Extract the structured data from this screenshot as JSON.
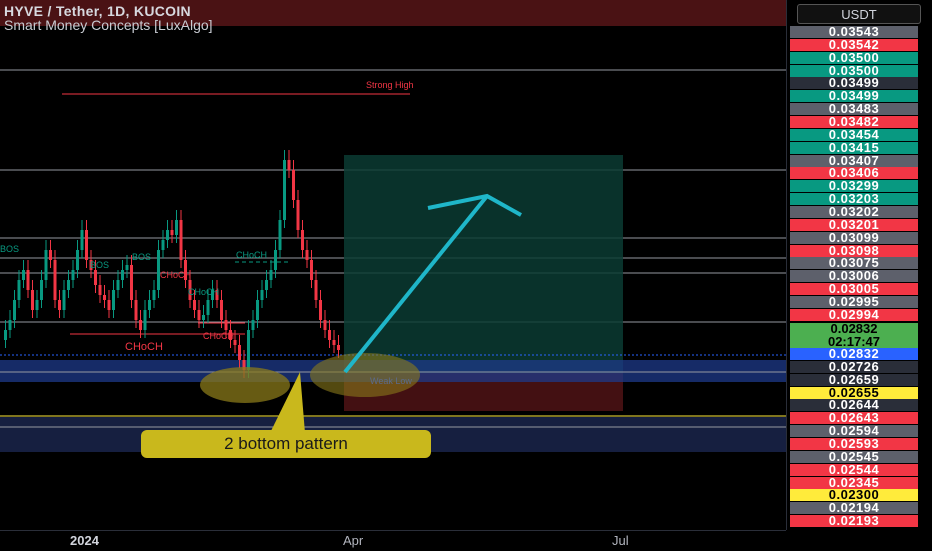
{
  "header": {
    "title": "HYVE / Tether, 1D, KUCOIN",
    "indicator": "Smart Money Concepts [LuxAlgo]"
  },
  "currency": "USDT",
  "price_labels": [
    {
      "v": "0.03543",
      "c": "gray"
    },
    {
      "v": "0.03542",
      "c": "red"
    },
    {
      "v": "0.03500",
      "c": "green"
    },
    {
      "v": "0.03500",
      "c": "green"
    },
    {
      "v": "0.03499",
      "c": "dark"
    },
    {
      "v": "0.03499",
      "c": "green"
    },
    {
      "v": "0.03483",
      "c": "gray"
    },
    {
      "v": "0.03482",
      "c": "red"
    },
    {
      "v": "0.03454",
      "c": "green"
    },
    {
      "v": "0.03415",
      "c": "green"
    },
    {
      "v": "0.03407",
      "c": "gray"
    },
    {
      "v": "0.03406",
      "c": "red"
    },
    {
      "v": "0.03299",
      "c": "green"
    },
    {
      "v": "0.03203",
      "c": "green"
    },
    {
      "v": "0.03202",
      "c": "gray"
    },
    {
      "v": "0.03201",
      "c": "red"
    },
    {
      "v": "0.03099",
      "c": "gray"
    },
    {
      "v": "0.03098",
      "c": "red"
    },
    {
      "v": "0.03075",
      "c": "gray"
    },
    {
      "v": "0.03006",
      "c": "gray"
    },
    {
      "v": "0.03005",
      "c": "red"
    },
    {
      "v": "0.02995",
      "c": "gray"
    },
    {
      "v": "0.02994",
      "c": "red"
    }
  ],
  "current_price": {
    "value": "0.02832",
    "countdown": "02:17:47"
  },
  "price_labels_lower": [
    {
      "v": "0.02832",
      "c": "blue"
    },
    {
      "v": "0.02726",
      "c": "dark"
    },
    {
      "v": "0.02659",
      "c": "dark"
    },
    {
      "v": "0.02655",
      "c": "yellow"
    },
    {
      "v": "0.02644",
      "c": "dark"
    },
    {
      "v": "0.02643",
      "c": "red"
    },
    {
      "v": "0.02594",
      "c": "gray"
    },
    {
      "v": "0.02593",
      "c": "red"
    },
    {
      "v": "0.02545",
      "c": "gray"
    },
    {
      "v": "0.02544",
      "c": "red"
    },
    {
      "v": "0.02345",
      "c": "red"
    },
    {
      "v": "0.02300",
      "c": "yellow"
    },
    {
      "v": "0.02194",
      "c": "gray"
    },
    {
      "v": "0.02193",
      "c": "red"
    }
  ],
  "time_axis": [
    {
      "label": "2024",
      "year": true
    },
    {
      "label": "Apr",
      "year": false
    },
    {
      "label": "Jul",
      "year": false
    }
  ],
  "annotations": {
    "strong_high": "Strong High",
    "weak_low": "Weak Low",
    "choch_main": "CHoCH",
    "choch_1": "CHoCH",
    "choch_2": "CHoCH",
    "choch_3": "CHoCH",
    "choch_4": "CHoCH",
    "bos_1": "BOS",
    "bos_2": "BOS",
    "bos_3": "BOS"
  },
  "callout": "2 bottom pattern",
  "colors": {
    "bull": "#089981",
    "bear": "#f23645",
    "arrow": "#1fb6c9",
    "callout": "#c9b81c",
    "zone_blue": "#1e3a8a"
  }
}
